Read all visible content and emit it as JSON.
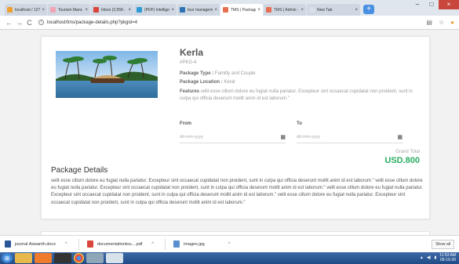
{
  "browser": {
    "tabs": [
      {
        "label": "localhost / 127.",
        "fav_color": "#f0a030",
        "active": false
      },
      {
        "label": "Tourism Manc",
        "fav_color": "#f3a3b3",
        "active": false
      },
      {
        "label": "Inbox (2,058 -",
        "fav_color": "#d9463b",
        "active": false
      },
      {
        "label": "(PDF) Intelligen",
        "fav_color": "#2e9bd6",
        "active": false
      },
      {
        "label": "tour managem",
        "fav_color": "#2f72b4",
        "active": false
      },
      {
        "label": "TMS | Package",
        "fav_color": "#e76f51",
        "active": true
      },
      {
        "label": "TMS | Admin :",
        "fav_color": "#e76f51",
        "active": false
      },
      {
        "label": "New Tab",
        "fav_color": "#d8dfe8",
        "active": false
      }
    ],
    "new_tab_symbol": "+",
    "url": "localhost/tms/package-details.php?pkgid=4",
    "nav": {
      "back": "←",
      "forward": "→",
      "reload": "C"
    }
  },
  "package": {
    "name": "Kerla",
    "code": "#PKG-4",
    "type_label": "Package Type :",
    "type_value": "Familty and Couple",
    "location_label": "Package Location :",
    "location_value": "Keral",
    "features_label": "Features",
    "features_value": "velit esse cillum dolore eu fugiat nulla pariatur. Excepteur sint occaecat cupidatat non proident, sunt in culpa qui officia deserunt mollit anim id est laborum.\""
  },
  "booking": {
    "from_label": "From",
    "to_label": "To",
    "from_placeholder": "dd-mm-yyyy",
    "to_placeholder": "dd-mm-yyyy",
    "grand_total_label": "Grand Total",
    "grand_total_value": "USD.800"
  },
  "details": {
    "title": "Package Details",
    "text": "velit esse cillum dolore eu fugiat nulla pariatur. Excepteur sint occaecat cupidatat non proident, sunt in culpa qui officia deserunt mollit anim id est laborum.\" velit esse cillum dolore eu fugiat nulla pariatur. Excepteur sint occaecat cupidatat non proident, sunt in culpa qui officia deserunt mollit anim id est laborum.\" velit esse cillum dolore eu fugiat nulla pariatur. Excepteur sint occaecat cupidatat non proident, sunt in culpa qui officia deserunt mollit anim id est laborum.\" velit esse cillum dolore eu fugiat nulla pariatur. Excepteur sint occaecat cupidatat non proident, sunt in culpa qui officia deserunt mollit anim id est laborum.\""
  },
  "downloads": {
    "items": [
      {
        "name": "journal Aswanth.docx",
        "icon_color": "#2b5797"
      },
      {
        "name": "documentationtou....pdf",
        "icon_color": "#d9463b"
      },
      {
        "name": "images.jpg",
        "icon_color": "#5b8fcf"
      }
    ],
    "show_all": "Show all"
  },
  "taskbar": {
    "time": "11:53 AM",
    "date": "09-10-20"
  },
  "colors": {
    "accent_green": "#27ae60",
    "active_tab": "#ffffff"
  }
}
